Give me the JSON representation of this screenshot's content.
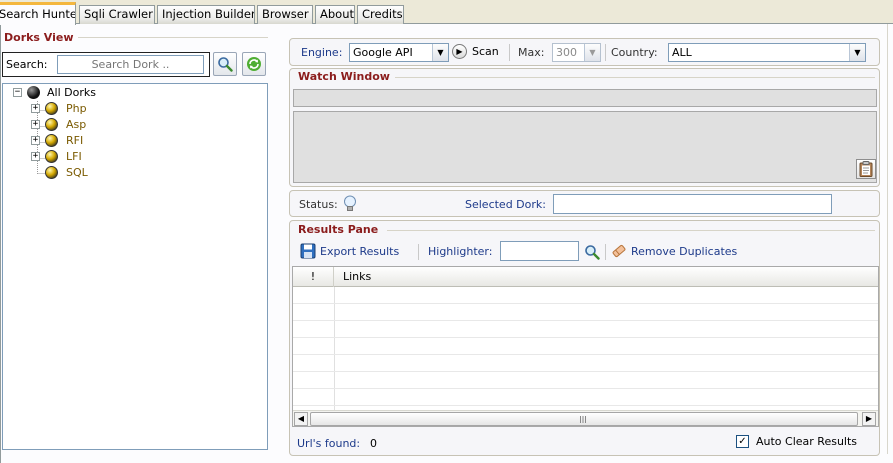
{
  "tabs": [
    {
      "label": "Search Hunter",
      "active": true
    },
    {
      "label": "Sqli Crawler",
      "active": false
    },
    {
      "label": "Injection Builder",
      "active": false
    },
    {
      "label": "Browser",
      "active": false
    },
    {
      "label": "About",
      "active": false
    },
    {
      "label": "Credits",
      "active": false
    }
  ],
  "dorks_view": {
    "title": "Dorks View",
    "search_label": "Search:",
    "search_placeholder": "Search Dork ..",
    "search_button_icon": "magnifier-icon",
    "refresh_button_icon": "refresh-icon"
  },
  "tree": {
    "root": "All Dorks",
    "children": [
      "Php",
      "Asp",
      "RFI",
      "LFI",
      "SQL"
    ]
  },
  "engine_bar": {
    "engine_label": "Engine:",
    "engine_value": "Google API",
    "scan_label": "Scan",
    "max_label": "Max:",
    "max_value": "300",
    "country_label": "Country:",
    "country_value": "ALL"
  },
  "watch_window": {
    "title": "Watch Window",
    "clipboard_icon": "clipboard-icon"
  },
  "status_bar": {
    "status_label": "Status:",
    "status_icon": "lightbulb-icon",
    "selected_dork_label": "Selected Dork:",
    "selected_dork_value": ""
  },
  "results": {
    "title": "Results Pane",
    "export_label": "Export Results",
    "highlighter_label": "Highlighter:",
    "highlighter_value": "",
    "remove_duplicates_label": "Remove Duplicates",
    "columns": [
      "!",
      "Links"
    ],
    "urls_found_label": "Url's found:",
    "urls_found_value": "0",
    "auto_clear_label": "Auto Clear Results",
    "auto_clear_checked": true
  },
  "colors": {
    "section_title": "#8b1c1c",
    "label_blue": "#1d3a8a",
    "active_tab_accent": "#f4b73e"
  }
}
